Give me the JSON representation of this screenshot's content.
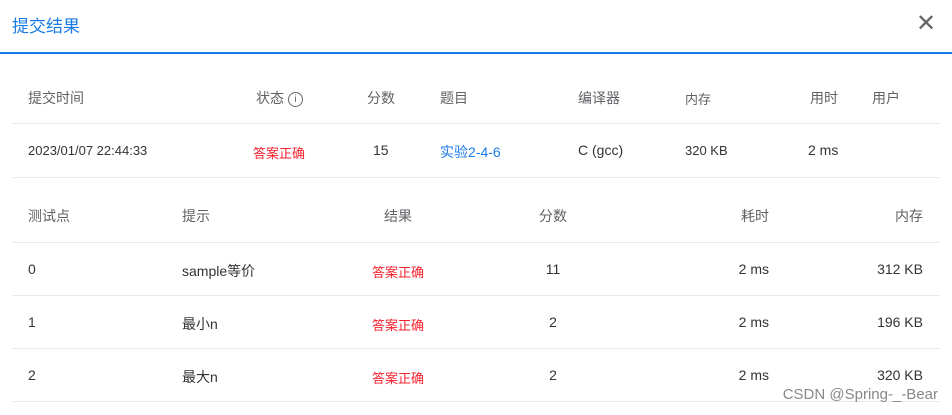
{
  "dialog": {
    "title": "提交结果",
    "close_icon": "close-icon"
  },
  "summary": {
    "headers": {
      "time": "提交时间",
      "status": "状态",
      "score": "分数",
      "problem": "题目",
      "compiler": "编译器",
      "memory": "内存",
      "duration": "用时",
      "user": "用户"
    },
    "row": {
      "time": "2023/01/07 22:44:33",
      "status": "答案正确",
      "score": "15",
      "problem": "实验2-4-6",
      "compiler": "C (gcc)",
      "memory": "320 KB",
      "duration": "2 ms",
      "user": ""
    }
  },
  "cases": {
    "headers": {
      "id": "测试点",
      "hint": "提示",
      "result": "结果",
      "score": "分数",
      "time": "耗时",
      "memory": "内存"
    },
    "rows": [
      {
        "id": "0",
        "hint": "sample等价",
        "result": "答案正确",
        "score": "11",
        "time": "2 ms",
        "memory": "312 KB"
      },
      {
        "id": "1",
        "hint": "最小n",
        "result": "答案正确",
        "score": "2",
        "time": "2 ms",
        "memory": "196 KB"
      },
      {
        "id": "2",
        "hint": "最大n",
        "result": "答案正确",
        "score": "2",
        "time": "2 ms",
        "memory": "320 KB"
      }
    ]
  },
  "colors": {
    "accent": "#1a7ae8",
    "success": "#f5222d"
  },
  "watermark": "CSDN @Spring-_-Bear"
}
